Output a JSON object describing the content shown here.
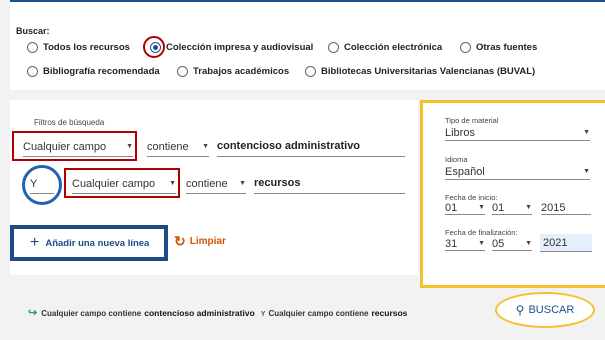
{
  "search_scope": {
    "label": "Buscar:",
    "options": [
      {
        "label": "Todos los recursos",
        "selected": false
      },
      {
        "label": "Colección impresa y audiovisual",
        "selected": true
      },
      {
        "label": "Colección electrónica",
        "selected": false
      },
      {
        "label": "Otras fuentes",
        "selected": false
      },
      {
        "label": "Bibliografía recomendada",
        "selected": false
      },
      {
        "label": "Trabajos académicos",
        "selected": false
      },
      {
        "label": "Bibliotecas Universitarias Valencianas (BUVAL)",
        "selected": false
      }
    ]
  },
  "filters": {
    "title": "Filtros de búsqueda",
    "rows": [
      {
        "operator": "",
        "field": "Cualquier campo",
        "condition": "contiene",
        "term": "contencioso administrativo"
      },
      {
        "operator": "Y",
        "field": "Cualquier campo",
        "condition": "contiene",
        "term": "recursos"
      }
    ],
    "add_line_label": "Añadir una nueva línea",
    "clear_label": "Limpiar"
  },
  "right_filters": {
    "material_type": {
      "label": "Tipo de material",
      "value": "Libros"
    },
    "language": {
      "label": "Idioma",
      "value": "Español"
    },
    "start_date": {
      "label": "Fecha de inicio:",
      "day": "01",
      "month": "01",
      "year": "2015"
    },
    "end_date": {
      "label": "Fecha de finalización:",
      "day": "31",
      "month": "05",
      "year": "2021"
    }
  },
  "summary": {
    "part1": "Cualquier campo contiene",
    "term1": "contencioso administrativo",
    "conj": "Y",
    "part2": "Cualquier campo contiene",
    "term2": "recursos"
  },
  "search_button": {
    "label": "BUSCAR"
  },
  "colors": {
    "primary": "#1f4e8c",
    "accent": "#d35400",
    "highlight_yellow": "#f2c12e",
    "highlight_red": "#b00000"
  }
}
